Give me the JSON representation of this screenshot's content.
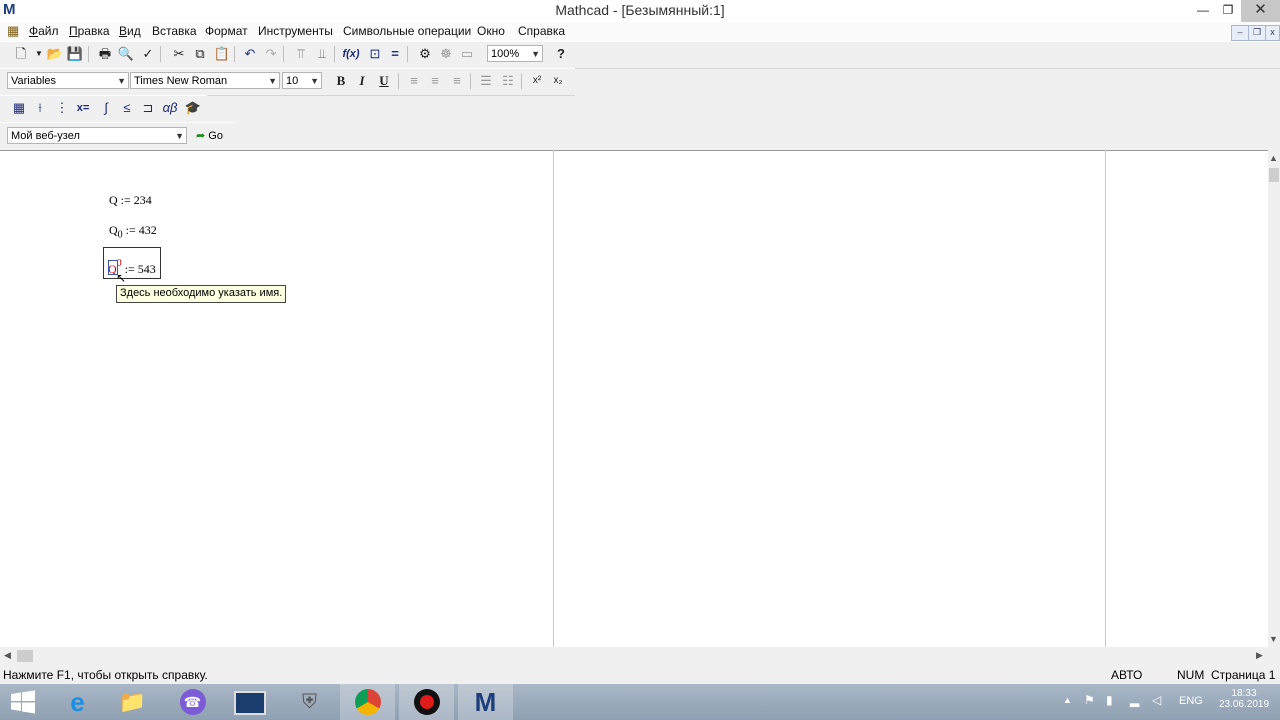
{
  "window": {
    "app_logo": "M",
    "title": "Mathcad - [Безымянный:1]",
    "minimize": "—",
    "restore": "❐",
    "close": "✕"
  },
  "menu": [
    {
      "u": "Ф",
      "rest": "айл"
    },
    {
      "u": "П",
      "rest": "равка"
    },
    {
      "u": "В",
      "rest": "ид"
    },
    {
      "u": "",
      "rest": "Вставка"
    },
    {
      "u": "",
      "rest": "Формат"
    },
    {
      "u": "",
      "rest": "Инструменты"
    },
    {
      "u": "",
      "rest": "Символьные операции"
    },
    {
      "u": "",
      "rest": "Окно"
    },
    {
      "u": "",
      "rest": "Справка"
    }
  ],
  "format_toolbar": {
    "style": "Variables",
    "font": "Times New Roman",
    "size": "10",
    "bold": "B",
    "italic": "I",
    "underline": "U",
    "superscript": "x²",
    "subscript": "x₂"
  },
  "standard_toolbar": {
    "zoom": "100%"
  },
  "web_toolbar": {
    "address": "Мой веб-узел",
    "go": "Go"
  },
  "worksheet": {
    "expr1": {
      "name": "Q",
      "op": ":=",
      "value": "234"
    },
    "expr2": {
      "name": "Q",
      "sub": "0",
      "op": ":=",
      "value": "432"
    },
    "expr3": {
      "name": "Q",
      "sup": "0",
      "op": ":=",
      "value": "543"
    },
    "tooltip": "Здесь необходимо указать имя."
  },
  "status": {
    "hint": "Нажмите F1, чтобы открыть справку.",
    "mode": "АВТО",
    "num": "NUM",
    "page": "Страница 1"
  },
  "taskbar": {
    "lang": "ENG",
    "time": "18:33",
    "date": "23.06.2019"
  },
  "colors": {
    "tooltip_bg": "#ffffe1",
    "error_red": "#d40000",
    "workspace": "#ffffff"
  }
}
